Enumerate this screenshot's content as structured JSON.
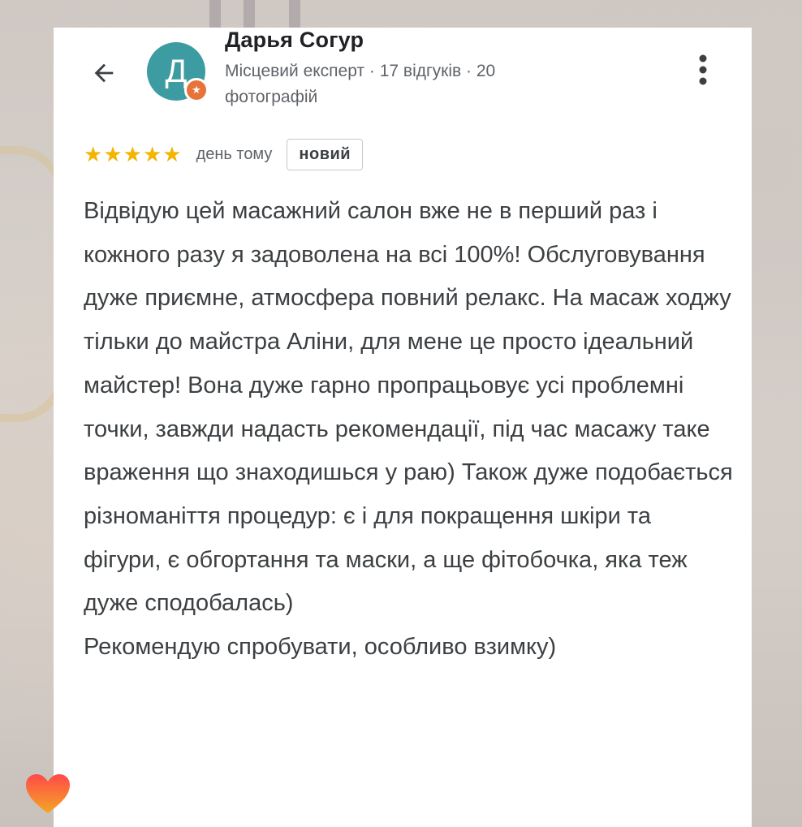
{
  "reviewer": {
    "avatar_letter": "Д",
    "name": "Дарья Согур",
    "meta": "Місцевий експерт · 17 відгуків · 20 фотографій"
  },
  "rating": {
    "stars": 5,
    "date": "день тому",
    "badge": "новий",
    "star_color": "#f4b400"
  },
  "review": {
    "text": "Відвідую цей масажний салон вже не в перший раз і кожного разу я задоволена на всі 100%! Обслуговування дуже приємне, атмосфера повний релакс. На масаж ходжу тільки до майстра Аліни, для мене це просто ідеальний майстер! Вона дуже гарно пропрацьовує усі проблемні точки, завжди надасть рекомендації, під час масажу таке враження що знаходишься у раю) Також дуже подобається різноманіття процедур: є і для покращення шкіри та фігури, є обгортання та маски, а ще фітобочка, яка теж дуже сподобалась)\nРекомендую спробувати, особливо взимку)"
  },
  "icons": {
    "back": "arrow-left-icon",
    "more": "more-vert-icon",
    "star": "star-icon",
    "badge": "local-guide-badge-icon",
    "reaction": "heart-icon"
  },
  "colors": {
    "avatar": "#3d9ca2",
    "guide_badge": "#e8733a",
    "heart_top": "#ff4a4a",
    "heart_bottom": "#f5a623"
  }
}
